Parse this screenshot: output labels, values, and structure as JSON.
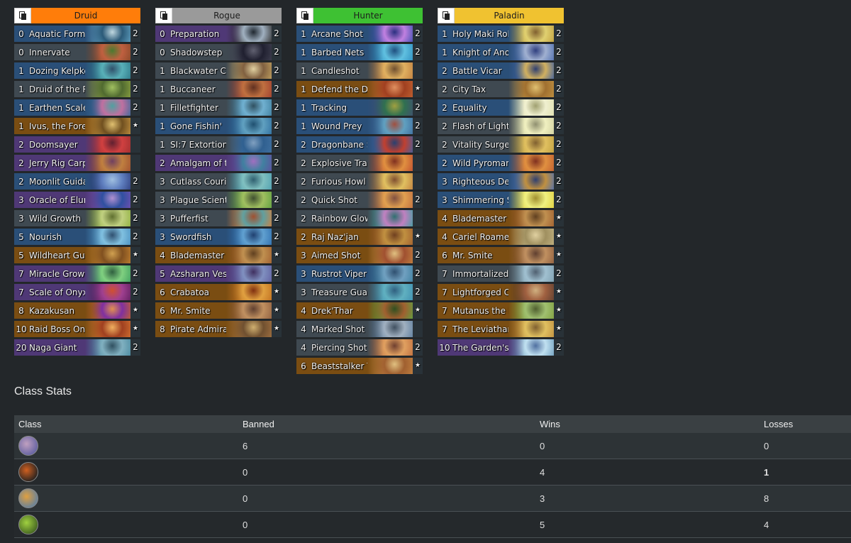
{
  "decks": [
    {
      "class": "Druid",
      "header_color": "#ff7d0a",
      "cards": [
        {
          "cost": "0",
          "name": "Aquatic Form",
          "count": "2",
          "rarity": "rare",
          "art": "#5fa0c0,#2b5a78,#c0d8e0"
        },
        {
          "cost": "0",
          "name": "Innervate",
          "count": "2",
          "rarity": "free",
          "art": "#8a4a2a,#c06040,#4a7a30"
        },
        {
          "cost": "1",
          "name": "Dozing Kelpkeeper",
          "count": "2",
          "rarity": "rare",
          "art": "#2f7a8a,#58b0b8,#30506a"
        },
        {
          "cost": "1",
          "name": "Druid of the Reef",
          "count": "2",
          "rarity": "common",
          "art": "#8aa040,#506a30,#a0c060"
        },
        {
          "cost": "1",
          "name": "Earthen Scales",
          "count": "2",
          "rarity": "rare",
          "art": "#3a6a9a,#c070a0,#50a0a0"
        },
        {
          "cost": "1",
          "name": "Ivus, the Forest Lord",
          "count": "★",
          "rarity": "legendary",
          "art": "#c09040,#705020,#e0c070"
        },
        {
          "cost": "2",
          "name": "Doomsayer",
          "count": "",
          "rarity": "epic",
          "art": "#a03030,#d04040,#602030"
        },
        {
          "cost": "2",
          "name": "Jerry Rig Carpenter",
          "count": "",
          "rarity": "epic",
          "art": "#a05030,#c08040,#704060"
        },
        {
          "cost": "2",
          "name": "Moonlit Guidance",
          "count": "2",
          "rarity": "rare",
          "art": "#304080,#6080c0,#a0c0e0"
        },
        {
          "cost": "3",
          "name": "Oracle of Elune",
          "count": "2",
          "rarity": "epic",
          "art": "#7050b0,#3050a0,#b090d0"
        },
        {
          "cost": "3",
          "name": "Wild Growth",
          "count": "2",
          "rarity": "free",
          "art": "#90b040,#c0d080,#607030"
        },
        {
          "cost": "5",
          "name": "Nourish",
          "count": "2",
          "rarity": "rare",
          "art": "#4a90c0,#80c0e0,#305070"
        },
        {
          "cost": "5",
          "name": "Wildheart Guff",
          "count": "★",
          "rarity": "legendary",
          "art": "#c08030,#805020,#d0a050"
        },
        {
          "cost": "7",
          "name": "Miracle Growth",
          "count": "2",
          "rarity": "epic",
          "art": "#40a060,#80d080,#306040"
        },
        {
          "cost": "7",
          "name": "Scale of Onyxia",
          "count": "2",
          "rarity": "epic",
          "art": "#602060,#a04090,#d05030"
        },
        {
          "cost": "8",
          "name": "Kazakusan",
          "count": "★",
          "rarity": "legendary",
          "art": "#c06030,#8030a0,#e09050"
        },
        {
          "cost": "10",
          "name": "Raid Boss Onyxia",
          "count": "★",
          "rarity": "legendary",
          "art": "#d07030,#a04020,#f0b060"
        },
        {
          "cost": "20",
          "name": "Naga Giant",
          "count": "2",
          "rarity": "epic",
          "art": "#4a8aa0,#80b0c0,#305060"
        }
      ]
    },
    {
      "class": "Rogue",
      "header_color": "#9a9a9a",
      "cards": [
        {
          "cost": "0",
          "name": "Preparation",
          "count": "2",
          "rarity": "epic",
          "art": "#303030,#a0b0c0,#202830"
        },
        {
          "cost": "0",
          "name": "Shadowstep",
          "count": "2",
          "rarity": "common",
          "art": "#404050,#202030,#606070"
        },
        {
          "cost": "1",
          "name": "Blackwater Cutlass",
          "count": "2",
          "rarity": "common",
          "art": "#c0a060,#806040,#e0d0a0"
        },
        {
          "cost": "1",
          "name": "Buccaneer",
          "count": "2",
          "rarity": "common",
          "art": "#a04030,#c07040,#603020"
        },
        {
          "cost": "1",
          "name": "Filletfighter",
          "count": "2",
          "rarity": "common",
          "art": "#4080a0,#70b0d0,#305060"
        },
        {
          "cost": "1",
          "name": "Gone Fishin'",
          "count": "2",
          "rarity": "rare",
          "art": "#3070a0,#60a0c0,#205070"
        },
        {
          "cost": "1",
          "name": "SI:7 Extortion",
          "count": "2",
          "rarity": "common",
          "art": "#4070a0,#306090,#80a0c0"
        },
        {
          "cost": "2",
          "name": "Amalgam of the Deep",
          "count": "2",
          "rarity": "epic",
          "art": "#6050a0,#4080a0,#a070c0"
        },
        {
          "cost": "3",
          "name": "Cutlass Courier",
          "count": "2",
          "rarity": "common",
          "art": "#50a0b0,#80c0c0,#306070"
        },
        {
          "cost": "3",
          "name": "Plague Scientist",
          "count": "2",
          "rarity": "common",
          "art": "#60a040,#a0c060,#405030"
        },
        {
          "cost": "3",
          "name": "Pufferfist",
          "count": "2",
          "rarity": "common",
          "art": "#d08040,#60a0a0,#a05030"
        },
        {
          "cost": "3",
          "name": "Swordfish",
          "count": "2",
          "rarity": "rare",
          "art": "#3070b0,#60a0d0,#204070"
        },
        {
          "cost": "4",
          "name": "Blademaster Okani",
          "count": "★",
          "rarity": "legendary",
          "art": "#a06030,#c09050,#604020"
        },
        {
          "cost": "5",
          "name": "Azsharan Vessel",
          "count": "2",
          "rarity": "epic",
          "art": "#6060a0,#8090c0,#403060"
        },
        {
          "cost": "6",
          "name": "Crabatoa",
          "count": "★",
          "rarity": "legendary",
          "art": "#c07020,#e0a040,#803010"
        },
        {
          "cost": "6",
          "name": "Mr. Smite",
          "count": "★",
          "rarity": "legendary",
          "art": "#906040,#c09060,#604030"
        },
        {
          "cost": "8",
          "name": "Pirate Admiral Hooktusk",
          "count": "★",
          "rarity": "legendary",
          "art": "#a07040,#705030,#d0b070"
        }
      ]
    },
    {
      "class": "Hunter",
      "header_color": "#3ec133",
      "cards": [
        {
          "cost": "1",
          "name": "Arcane Shot",
          "count": "2",
          "rarity": "rare",
          "art": "#4050b0,#c080e0,#2a3080"
        },
        {
          "cost": "1",
          "name": "Barbed Nets",
          "count": "2",
          "rarity": "rare",
          "art": "#3090c0,#60c0e0,#205080"
        },
        {
          "cost": "1",
          "name": "Candleshot",
          "count": "",
          "rarity": "common",
          "art": "#c08040,#e0b060,#705030"
        },
        {
          "cost": "1",
          "name": "Defend the Dwarven District",
          "count": "★",
          "rarity": "legendary",
          "art": "#c06030,#a04020,#e09060"
        },
        {
          "cost": "1",
          "name": "Tracking",
          "count": "2",
          "rarity": "rare",
          "art": "#405070,#307050,#a0a040"
        },
        {
          "cost": "1",
          "name": "Wound Prey",
          "count": "2",
          "rarity": "rare",
          "art": "#4070a0,#60a0c0,#a05040"
        },
        {
          "cost": "2",
          "name": "Dragonbane Shot",
          "count": "2",
          "rarity": "rare",
          "art": "#4060a0,#c04030,#2a4070"
        },
        {
          "cost": "2",
          "name": "Explosive Trap",
          "count": "",
          "rarity": "common",
          "art": "#c05030,#e09040,#803020"
        },
        {
          "cost": "2",
          "name": "Furious Howl",
          "count": "",
          "rarity": "common",
          "art": "#c08040,#e0c060,#805030"
        },
        {
          "cost": "2",
          "name": "Quick Shot",
          "count": "2",
          "rarity": "common",
          "art": "#c07040,#e0a050,#805040"
        },
        {
          "cost": "2",
          "name": "Rainbow Glowscale",
          "count": "",
          "rarity": "common",
          "art": "#40a0a0,#c080c0,#307070"
        },
        {
          "cost": "2",
          "name": "Raj Naz'jan",
          "count": "★",
          "rarity": "legendary",
          "art": "#a06030,#c09040,#704020"
        },
        {
          "cost": "3",
          "name": "Aimed Shot",
          "count": "2",
          "rarity": "legendary",
          "art": "#c08040,#a05030,#e0c080"
        },
        {
          "cost": "3",
          "name": "Rustrot Viper",
          "count": "2",
          "rarity": "rare",
          "art": "#4080a0,#70a0c0,#305070"
        },
        {
          "cost": "3",
          "name": "Treasure Guard",
          "count": "2",
          "rarity": "common",
          "art": "#4090b0,#60b0c0,#306080"
        },
        {
          "cost": "4",
          "name": "Drek'Thar",
          "count": "★",
          "rarity": "legendary",
          "art": "#60a040,#a06030,#305020"
        },
        {
          "cost": "4",
          "name": "Marked Shot",
          "count": "",
          "rarity": "common",
          "art": "#6080a0,#a0b0c0,#405060"
        },
        {
          "cost": "4",
          "name": "Piercing Shot",
          "count": "2",
          "rarity": "common",
          "art": "#c07040,#e0a060,#704030"
        },
        {
          "cost": "6",
          "name": "Beaststalker Tavish",
          "count": "★",
          "rarity": "legendary",
          "art": "#c08040,#a06030,#e0c080"
        }
      ]
    },
    {
      "class": "Paladin",
      "header_color": "#f0c230",
      "cards": [
        {
          "cost": "1",
          "name": "Holy Maki Roll",
          "count": "2",
          "rarity": "rare",
          "art": "#c0a040,#e0d070,#806030"
        },
        {
          "cost": "1",
          "name": "Knight of Anointment",
          "count": "2",
          "rarity": "rare",
          "art": "#5070b0,#a0b0d0,#304080"
        },
        {
          "cost": "2",
          "name": "Battle Vicar",
          "count": "2",
          "rarity": "rare",
          "art": "#4060a0,#d0b060,#304070"
        },
        {
          "cost": "2",
          "name": "City Tax",
          "count": "2",
          "rarity": "common",
          "art": "#c09040,#a07030,#e0c070"
        },
        {
          "cost": "2",
          "name": "Equality",
          "count": "2",
          "rarity": "rare",
          "art": "#e0e0b0,#f0f0d0,#a0a070"
        },
        {
          "cost": "2",
          "name": "Flash of Light",
          "count": "2",
          "rarity": "common",
          "art": "#d0d0a0,#f0f0c0,#909070"
        },
        {
          "cost": "2",
          "name": "Vitality Surge",
          "count": "2",
          "rarity": "common",
          "art": "#c0a040,#e0c060,#806030"
        },
        {
          "cost": "2",
          "name": "Wild Pyromancer",
          "count": "2",
          "rarity": "rare",
          "art": "#c06030,#e09040,#803020"
        },
        {
          "cost": "3",
          "name": "Righteous Defense",
          "count": "2",
          "rarity": "rare",
          "art": "#5070b0,#c09040,#304070"
        },
        {
          "cost": "3",
          "name": "Shimmering Sunfish",
          "count": "2",
          "rarity": "rare",
          "art": "#e0d040,#f0f080,#a09030"
        },
        {
          "cost": "4",
          "name": "Blademaster Okani",
          "count": "★",
          "rarity": "legendary",
          "art": "#a06030,#c09050,#604020"
        },
        {
          "cost": "4",
          "name": "Cariel Roame",
          "count": "★",
          "rarity": "legendary",
          "art": "#c0b080,#a09060,#e0d0a0"
        },
        {
          "cost": "6",
          "name": "Mr. Smite",
          "count": "★",
          "rarity": "legendary",
          "art": "#906040,#c09060,#604030"
        },
        {
          "cost": "7",
          "name": "Immortalized in Stone",
          "count": "2",
          "rarity": "common",
          "art": "#80a0b0,#a0c0d0,#506070"
        },
        {
          "cost": "7",
          "name": "Lightforged Cariel",
          "count": "★",
          "rarity": "legendary",
          "art": "#604030,#a06040,#d0b080"
        },
        {
          "cost": "7",
          "name": "Mutanus the Devourer",
          "count": "★",
          "rarity": "legendary",
          "art": "#80a040,#a0c070,#506030"
        },
        {
          "cost": "7",
          "name": "The Leviathan",
          "count": "★",
          "rarity": "legendary",
          "art": "#c09040,#e0c060,#806030"
        },
        {
          "cost": "10",
          "name": "The Garden's Grace",
          "count": "2",
          "rarity": "epic",
          "art": "#70a0c0,#c0e0f0,#5070a0"
        }
      ]
    }
  ],
  "class_stats": {
    "title": "Class Stats",
    "headers": {
      "class": "Class",
      "banned": "Banned",
      "wins": "Wins",
      "losses": "Losses"
    },
    "rows": [
      {
        "icon": "mage-class-icon",
        "icon_colors": "#c0a0c0,#6060a0",
        "banned": "6",
        "wins": "0",
        "losses": "0",
        "losses_bold": false
      },
      {
        "icon": "rogue-class-icon",
        "icon_colors": "#d06020,#202020",
        "banned": "0",
        "wins": "4",
        "losses": "1",
        "losses_bold": true
      },
      {
        "icon": "hunter-class-icon",
        "icon_colors": "#e0a040,#6080a0",
        "banned": "0",
        "wins": "3",
        "losses": "8",
        "losses_bold": false
      },
      {
        "icon": "druid-class-icon",
        "icon_colors": "#a0d040,#406020",
        "banned": "0",
        "wins": "5",
        "losses": "4",
        "losses_bold": false
      }
    ]
  }
}
